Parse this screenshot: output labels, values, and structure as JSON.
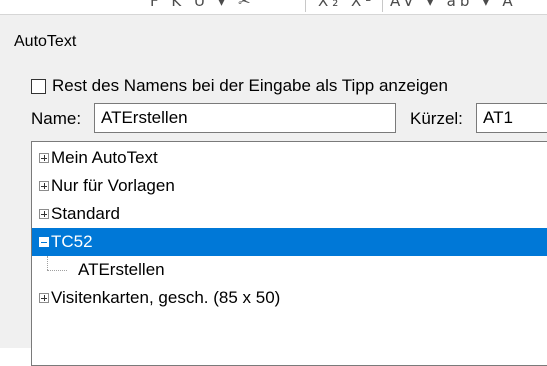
{
  "dialog": {
    "title": "AutoText"
  },
  "options": {
    "show_remainder_label": "Rest des Namens bei der Eingabe als Tipp anzeigen",
    "show_remainder_checked": false
  },
  "fields": {
    "name_label": "Name:",
    "name_value": "ATErstellen",
    "shortcut_label": "Kürzel:",
    "shortcut_value": "AT1"
  },
  "tree": {
    "items": [
      {
        "label": "Mein AutoText",
        "expander": "plus",
        "selected": false
      },
      {
        "label": "Nur für Vorlagen",
        "expander": "plus",
        "selected": false
      },
      {
        "label": "Standard",
        "expander": "plus",
        "selected": false
      },
      {
        "label": "TC52",
        "expander": "minus",
        "selected": true
      },
      {
        "label": "ATErstellen",
        "expander": "none",
        "selected": false,
        "child": true
      },
      {
        "label": "Visitenkarten, gesch. (85 x 50)",
        "expander": "plus",
        "selected": false
      }
    ]
  },
  "colors": {
    "selection": "#0078d7",
    "dialog_bg": "#f0f0f0"
  }
}
